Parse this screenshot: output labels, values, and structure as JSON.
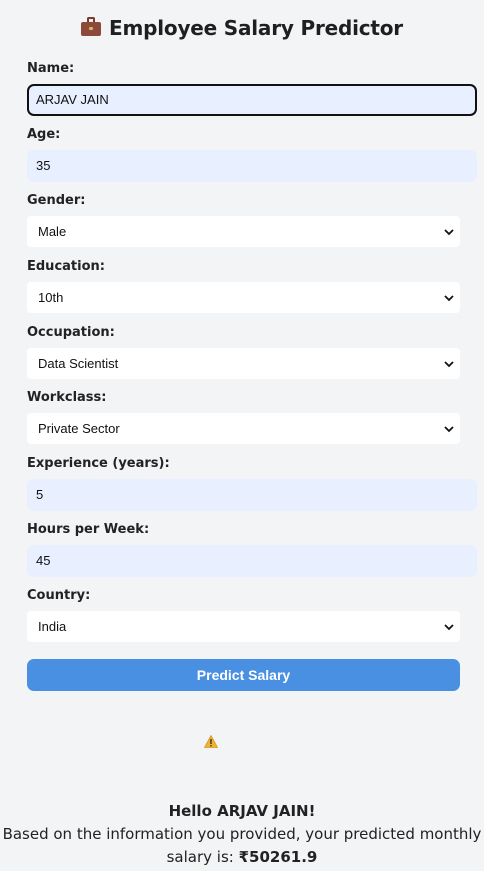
{
  "header": {
    "title": "Employee Salary Predictor",
    "title_icon": "briefcase-icon"
  },
  "form": {
    "name": {
      "label": "Name:",
      "value": "ARJAV JAIN"
    },
    "age": {
      "label": "Age:",
      "value": "35"
    },
    "gender": {
      "label": "Gender:",
      "value": "Male"
    },
    "education": {
      "label": "Education:",
      "value": "10th"
    },
    "occupation": {
      "label": "Occupation:",
      "value": "Data Scientist"
    },
    "workclass": {
      "label": "Workclass:",
      "value": "Private Sector"
    },
    "experience": {
      "label": "Experience (years):",
      "value": "5"
    },
    "hours": {
      "label": "Hours per Week:",
      "value": "45"
    },
    "country": {
      "label": "Country:",
      "value": "India"
    },
    "submit_label": "Predict Salary"
  },
  "result": {
    "warning_icon": "warning-icon",
    "greeting": "Hello ARJAV JAIN!",
    "message": "Based on the information you provided, your predicted monthly salary is:",
    "salary": "₹50261.9"
  },
  "colors": {
    "background": "#f2f4f5",
    "input_bg": "#e8efff",
    "button": "#4a90e2"
  }
}
